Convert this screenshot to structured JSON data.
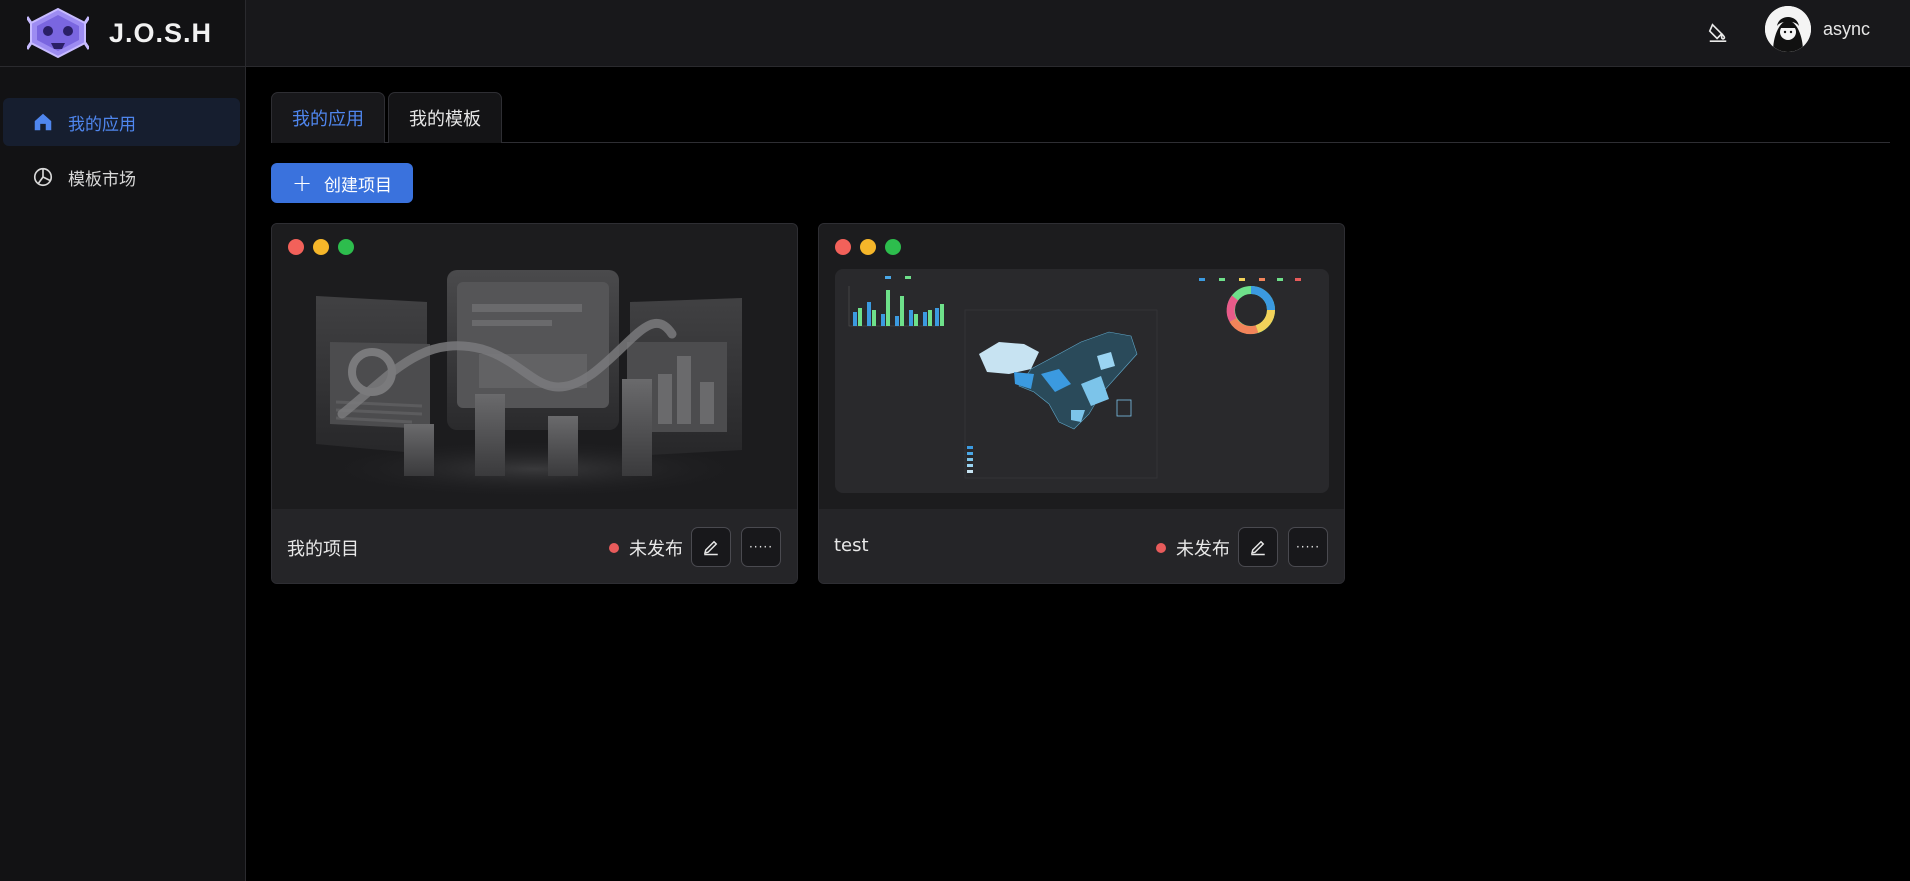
{
  "app": {
    "name": "J.O.S.H"
  },
  "sidebar": {
    "items": [
      {
        "label": "我的应用",
        "icon": "home-icon",
        "active": true
      },
      {
        "label": "模板市场",
        "icon": "pie-chart-icon",
        "active": false
      }
    ]
  },
  "header": {
    "theme_icon": "paint-bucket-icon",
    "username": "async"
  },
  "tabs": [
    {
      "label": "我的应用",
      "active": true
    },
    {
      "label": "我的模板",
      "active": false
    }
  ],
  "toolbar": {
    "create_label": "创建项目"
  },
  "projects": [
    {
      "title": "我的项目",
      "status": "未发布",
      "more_label": "·····"
    },
    {
      "title": "test",
      "status": "未发布",
      "more_label": "·····"
    }
  ],
  "colors": {
    "accent": "#3a72dd",
    "status_unpublished": "#e85b5b"
  }
}
